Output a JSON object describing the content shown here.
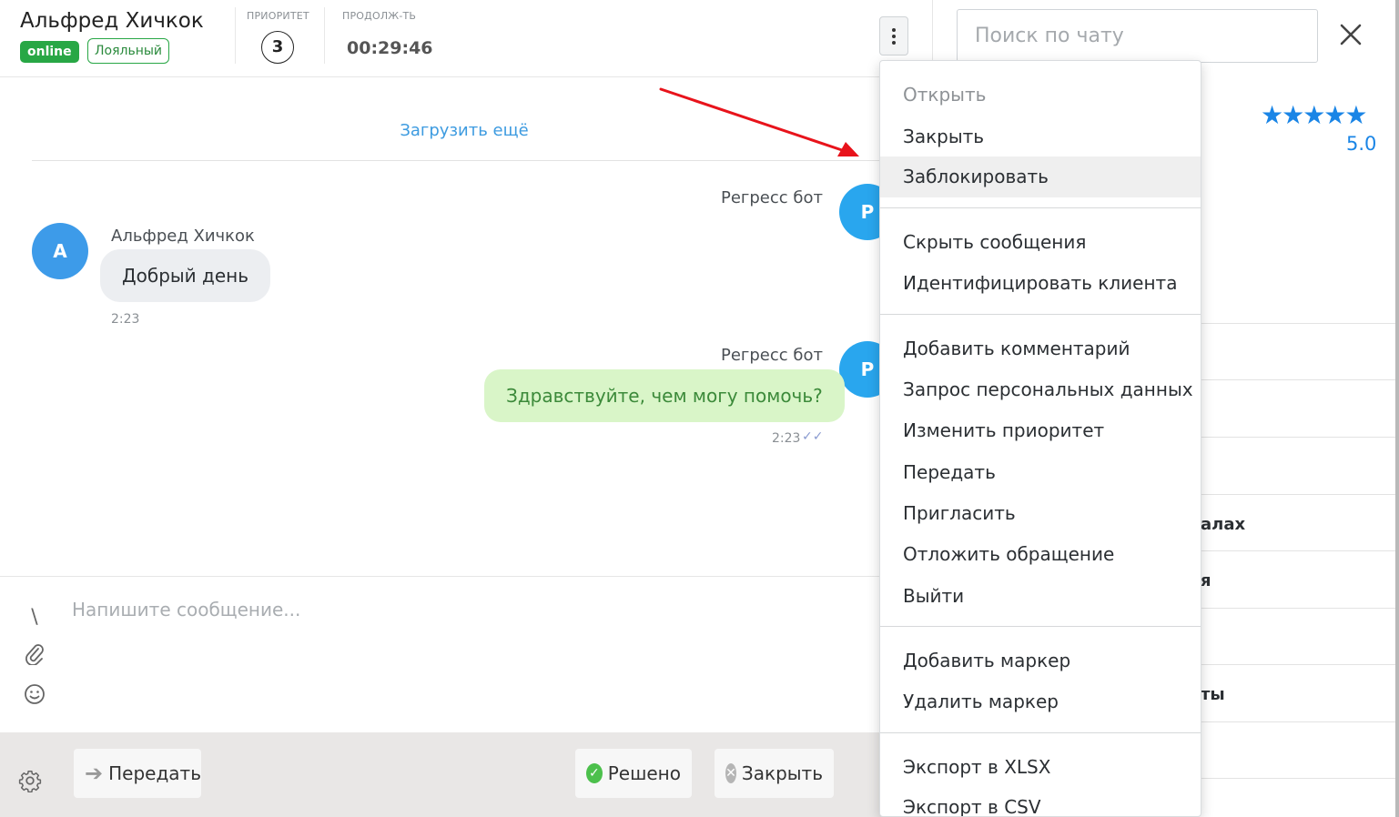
{
  "header": {
    "client_name": "Альфред Хичкок",
    "status_badge": "online",
    "segment_badge": "Лояльный",
    "priority_label": "ПРИОРИТЕТ",
    "priority_value": "3",
    "duration_label": "ПРОДОЛЖ-ТЬ",
    "duration_value": "00:29:46"
  },
  "chat": {
    "load_more": "Загрузить ещё",
    "messages": [
      {
        "sender": "Регресс бот",
        "avatar": "Р"
      },
      {
        "sender": "Альфред Хичкок",
        "avatar": "А",
        "text": "Добрый день",
        "time": "2:23"
      },
      {
        "sender": "Регресс бот",
        "avatar": "Р",
        "text": "Здравствуйте, чем могу помочь?",
        "time": "2:23"
      }
    ],
    "composer_placeholder": "Напишите сообщение..."
  },
  "bottom_bar": {
    "transfer_label": "Передать",
    "resolved_label": "Решено",
    "close_label": "Закрыть"
  },
  "right_panel": {
    "search_placeholder": "Поиск по чату",
    "rating": "5.0",
    "rows": [
      "алах",
      "я",
      "ты"
    ]
  },
  "menu": {
    "items": [
      "Открыть",
      "Закрыть",
      "Заблокировать",
      "Скрыть сообщения",
      "Идентифицировать клиента",
      "Добавить комментарий",
      "Запрос персональных данных",
      "Изменить приоритет",
      "Передать",
      "Пригласить",
      "Отложить обращение",
      "Выйти",
      "Добавить маркер",
      "Удалить маркер",
      "Экспорт в XLSX",
      "Экспорт в CSV"
    ]
  },
  "colors": {
    "accent_blue": "#1a85e6",
    "online_green": "#28a745",
    "outgoing_bubble": "#d9f5c8",
    "annotation_arrow": "#e8131b"
  }
}
